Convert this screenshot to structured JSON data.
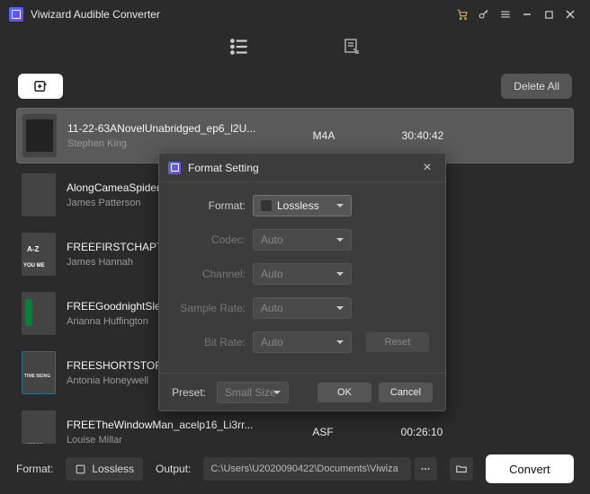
{
  "app": {
    "title": "Viwizard Audible Converter"
  },
  "actions": {
    "delete_all": "Delete All"
  },
  "tracks": [
    {
      "title": "11-22-63ANovelUnabridged_ep6_l2U...",
      "author": "Stephen King",
      "format": "M4A",
      "duration": "30:40:42",
      "selected": true
    },
    {
      "title": "AlongCameaSpider",
      "author": "James Patterson",
      "format": "",
      "duration": "",
      "selected": false
    },
    {
      "title": "FREEFIRSTCHAPTER",
      "author": "James Hannah",
      "format": "",
      "duration": "",
      "selected": false
    },
    {
      "title": "FREEGoodnightSleep",
      "author": "Arianna Huffington",
      "format": "",
      "duration": "",
      "selected": false
    },
    {
      "title": "FREESHORTSTORY",
      "author": "Antonia Honeywell",
      "format": "",
      "duration": "",
      "selected": false
    },
    {
      "title": "FREETheWindowMan_acelp16_Li3rr...",
      "author": "Louise Millar",
      "format": "ASF",
      "duration": "00:26:10",
      "selected": false
    }
  ],
  "footer": {
    "format_label": "Format:",
    "format_value": "Lossless",
    "output_label": "Output:",
    "output_path": "C:\\Users\\U2020090422\\Documents\\Viwiza",
    "convert": "Convert"
  },
  "modal": {
    "title": "Format Setting",
    "format_label": "Format:",
    "format_value": "Lossless",
    "codec_label": "Codec:",
    "codec_value": "Auto",
    "channel_label": "Channel:",
    "channel_value": "Auto",
    "samplerate_label": "Sample Rate:",
    "samplerate_value": "Auto",
    "bitrate_label": "Bit Rate:",
    "bitrate_value": "Auto",
    "reset": "Reset",
    "preset_label": "Preset:",
    "preset_value": "Small Size",
    "ok": "OK",
    "cancel": "Cancel"
  }
}
